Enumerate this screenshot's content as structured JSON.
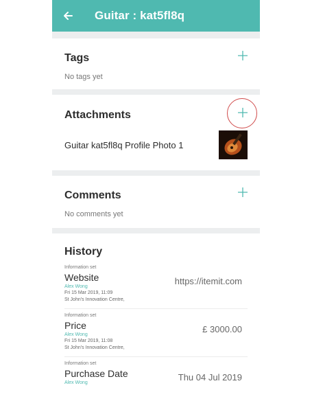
{
  "header": {
    "title": "Guitar : kat5fl8q",
    "back_icon": "arrow-left-icon",
    "bar_color": "#4fb9b0"
  },
  "tags": {
    "title": "Tags",
    "empty_text": "No tags yet",
    "add_icon": "plus-icon"
  },
  "attachments": {
    "title": "Attachments",
    "add_icon": "plus-icon",
    "items": [
      {
        "name": "Guitar kat5fl8q Profile Photo 1"
      }
    ]
  },
  "comments": {
    "title": "Comments",
    "empty_text": "No comments yet",
    "add_icon": "plus-icon"
  },
  "history": {
    "title": "History",
    "items": [
      {
        "label": "Information set",
        "field": "Website",
        "user": "Alex Wong",
        "timestamp": "Fri 15 Mar 2019, 11:09",
        "location": "St John's Innovation Centre,",
        "value": "https://itemit.com"
      },
      {
        "label": "Information set",
        "field": "Price",
        "user": "Alex Wong",
        "timestamp": "Fri 15 Mar 2019, 11:08",
        "location": "St John's Innovation Centre,",
        "value": "£ 3000.00"
      },
      {
        "label": "Information set",
        "field": "Purchase Date",
        "user": "Alex Wong",
        "value": "Thu 04 Jul 2019"
      }
    ]
  },
  "colors": {
    "accent": "#4fb9b0",
    "highlight_ring": "#d04a4a"
  }
}
